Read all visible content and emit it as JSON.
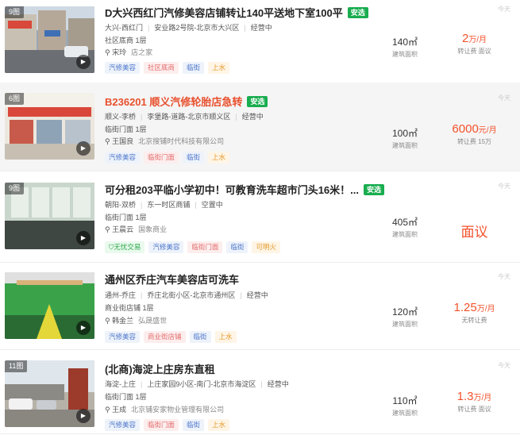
{
  "listings": [
    {
      "count": "9图",
      "title": "D大兴西红门汽修美容店铺转让140平送地下室100平",
      "title_red": false,
      "select": "安选",
      "district": "大兴-西红门",
      "road": "安业路2号院-北京市大兴区",
      "status": "经营中",
      "type_floor": "社区底商 1层",
      "owner": "宋玲",
      "company": "店之家",
      "tags": [
        "汽修美容",
        "社区底商",
        "临街",
        "上水"
      ],
      "area": "140㎡",
      "area_label": "建筑面积",
      "price": "2",
      "price_unit": "万/月",
      "price_label": "转让费  面议",
      "time": "今天"
    },
    {
      "count": "6图",
      "title": "B236201 顺义汽修轮胎店急转",
      "title_red": true,
      "select": "安选",
      "district": "顺义-李桥",
      "road": "李堡路-道路-北京市顺义区",
      "status": "经营中",
      "type_floor": "临街门面 1层",
      "owner": "王国良",
      "company": "北京搜铺时代科技有限公司",
      "tags": [
        "汽修美容",
        "临街门面",
        "临街",
        "上水"
      ],
      "area": "100㎡",
      "area_label": "建筑面积",
      "price": "6000",
      "price_unit": "元/月",
      "price_label": "转让费  15万",
      "time": "今天"
    },
    {
      "count": "9图",
      "title": "可分租203平临小学初中！可教育洗车超市门头16米！...",
      "title_red": false,
      "select": "安选",
      "district": "朝阳-双桥",
      "road": "东一时区商铺",
      "status": "空置中",
      "type_floor": "临街门面 1层",
      "owner": "王晨云",
      "company": "国象商业",
      "tags": [
        "无忧交易",
        "汽修美容",
        "临街门面",
        "临街",
        "可明火"
      ],
      "area": "405㎡",
      "area_label": "建筑面积",
      "price": "面议",
      "price_unit": "",
      "price_label": "",
      "time": "今天"
    },
    {
      "count": "",
      "title": "通州区乔庄汽车美容店可洗车",
      "title_red": false,
      "select": "",
      "district": "通州-乔庄",
      "road": "乔庄北街小区-北京市通州区",
      "status": "经营中",
      "type_floor": "商业街店铺 1层",
      "owner": "韩金兰",
      "company": "弘晟盛世",
      "tags": [
        "汽修美容",
        "商业街店铺",
        "临街",
        "上水"
      ],
      "area": "120㎡",
      "area_label": "建筑面积",
      "price": "1.25",
      "price_unit": "万/月",
      "price_label": "无转让费",
      "time": "今天"
    },
    {
      "count": "11图",
      "title": "(北商)海淀上庄房东直租",
      "title_red": false,
      "select": "",
      "district": "海淀-上庄",
      "road": "上庄家园9小区-南门-北京市海淀区",
      "status": "经营中",
      "type_floor": "临街门面 1层",
      "owner": "王成",
      "company": "北京铺安家物业管理有限公司",
      "tags": [
        "汽修美容",
        "临街门面",
        "临街",
        "上水"
      ],
      "area": "110㎡",
      "area_label": "建筑面积",
      "price": "1.3",
      "price_unit": "万/月",
      "price_label": "转让费  面议",
      "time": "今天"
    }
  ]
}
